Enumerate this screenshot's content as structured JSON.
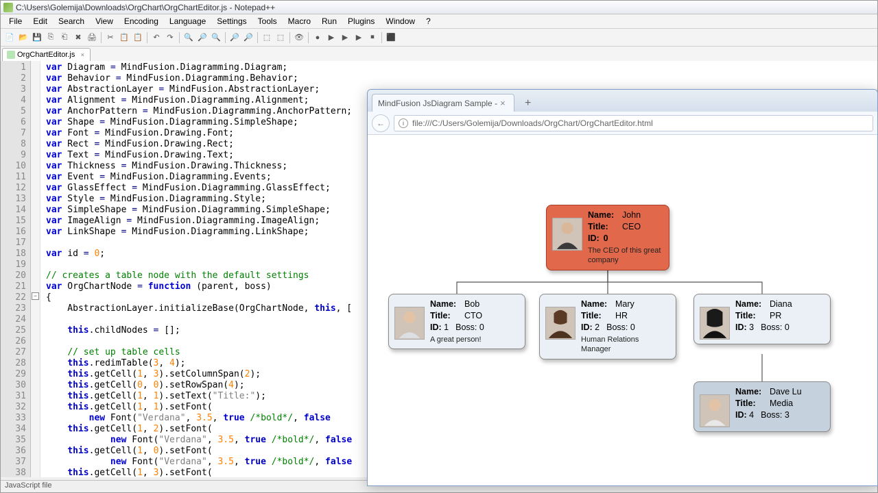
{
  "npp": {
    "title": "C:\\Users\\Golemija\\Downloads\\OrgChart\\OrgChartEditor.js - Notepad++",
    "menus": [
      "File",
      "Edit",
      "Search",
      "View",
      "Encoding",
      "Language",
      "Settings",
      "Tools",
      "Macro",
      "Run",
      "Plugins",
      "Window",
      "?"
    ],
    "tab": "OrgChartEditor.js",
    "status": "JavaScript file",
    "foldLine": 22
  },
  "code": [
    {
      "n": 1,
      "t": "<kw>var</kw> Diagram <op>=</op> MindFusion.Diagramming.Diagram;"
    },
    {
      "n": 2,
      "t": "<kw>var</kw> Behavior <op>=</op> MindFusion.Diagramming.Behavior;"
    },
    {
      "n": 3,
      "t": "<kw>var</kw> AbstractionLayer <op>=</op> MindFusion.AbstractionLayer;"
    },
    {
      "n": 4,
      "t": "<kw>var</kw> Alignment <op>=</op> MindFusion.Diagramming.Alignment;"
    },
    {
      "n": 5,
      "t": "<kw>var</kw> AnchorPattern <op>=</op> MindFusion.Diagramming.AnchorPattern;"
    },
    {
      "n": 6,
      "t": "<kw>var</kw> Shape <op>=</op> MindFusion.Diagramming.SimpleShape;"
    },
    {
      "n": 7,
      "t": "<kw>var</kw> Font <op>=</op> MindFusion.Drawing.Font;"
    },
    {
      "n": 8,
      "t": "<kw>var</kw> Rect <op>=</op> MindFusion.Drawing.Rect;"
    },
    {
      "n": 9,
      "t": "<kw>var</kw> Text <op>=</op> MindFusion.Drawing.Text;"
    },
    {
      "n": 10,
      "t": "<kw>var</kw> Thickness <op>=</op> MindFusion.Drawing.Thickness;"
    },
    {
      "n": 11,
      "t": "<kw>var</kw> Event <op>=</op> MindFusion.Diagramming.Events;"
    },
    {
      "n": 12,
      "t": "<kw>var</kw> GlassEffect <op>=</op> MindFusion.Diagramming.GlassEffect;"
    },
    {
      "n": 13,
      "t": "<kw>var</kw> Style <op>=</op> MindFusion.Diagramming.Style;"
    },
    {
      "n": 14,
      "t": "<kw>var</kw> SimpleShape <op>=</op> MindFusion.Diagramming.SimpleShape;"
    },
    {
      "n": 15,
      "t": "<kw>var</kw> ImageAlign <op>=</op> MindFusion.Diagramming.ImageAlign;"
    },
    {
      "n": 16,
      "t": "<kw>var</kw> LinkShape <op>=</op> MindFusion.Diagramming.LinkShape;"
    },
    {
      "n": 17,
      "t": ""
    },
    {
      "n": 18,
      "t": "<kw>var</kw> id <op>=</op> <num>0</num>;"
    },
    {
      "n": 19,
      "t": ""
    },
    {
      "n": 20,
      "t": "<cm>// creates a table node with the default settings</cm>"
    },
    {
      "n": 21,
      "t": "<kw>var</kw> OrgChartNode <op>=</op> <kw>function</kw> (parent, boss)"
    },
    {
      "n": 22,
      "t": "{"
    },
    {
      "n": 23,
      "t": "    AbstractionLayer.initializeBase(OrgChartNode, <kw>this</kw>, ["
    },
    {
      "n": 24,
      "t": ""
    },
    {
      "n": 25,
      "t": "    <kw>this</kw>.childNodes <op>=</op> [];"
    },
    {
      "n": 26,
      "t": ""
    },
    {
      "n": 27,
      "t": "    <cm>// set up table cells</cm>"
    },
    {
      "n": 28,
      "t": "    <kw>this</kw>.redimTable(<num>3</num>, <num>4</num>);"
    },
    {
      "n": 29,
      "t": "    <kw>this</kw>.getCell(<num>1</num>, <num>3</num>).setColumnSpan(<num>2</num>);"
    },
    {
      "n": 30,
      "t": "    <kw>this</kw>.getCell(<num>0</num>, <num>0</num>).setRowSpan(<num>4</num>);"
    },
    {
      "n": 31,
      "t": "    <kw>this</kw>.getCell(<num>1</num>, <num>1</num>).setText(<str>\"Title:\"</str>);"
    },
    {
      "n": 32,
      "t": "    <kw>this</kw>.getCell(<num>1</num>, <num>1</num>).setFont("
    },
    {
      "n": 33,
      "t": "        <kw>new</kw> Font(<str>\"Verdana\"</str>, <num>3.5</num>, <kw>true</kw> <cm>/*bold*/</cm>, <kw>false</kw>"
    },
    {
      "n": 34,
      "t": "    <kw>this</kw>.getCell(<num>1</num>, <num>2</num>).setFont("
    },
    {
      "n": 35,
      "t": "            <kw>new</kw> Font(<str>\"Verdana\"</str>, <num>3.5</num>, <kw>true</kw> <cm>/*bold*/</cm>, <kw>false</kw>"
    },
    {
      "n": 36,
      "t": "    <kw>this</kw>.getCell(<num>1</num>, <num>0</num>).setFont("
    },
    {
      "n": 37,
      "t": "            <kw>new</kw> Font(<str>\"Verdana\"</str>, <num>3.5</num>, <kw>true</kw> <cm>/*bold*/</cm>, <kw>false</kw>"
    },
    {
      "n": 38,
      "t": "    <kw>this</kw>.getCell(<num>1</num>, <num>3</num>).setFont("
    }
  ],
  "browser": {
    "tabTitle": "MindFusion JsDiagram Sample -",
    "url": "file:///C:/Users/Golemija/Downloads/OrgChart/OrgChartEditor.html"
  },
  "labels": {
    "name": "Name:",
    "title": "Title:",
    "id": "ID:",
    "boss": "Boss:"
  },
  "nodes": {
    "root": {
      "name": "John",
      "title": "CEO",
      "id": "0",
      "comment": "The CEO of this great company"
    },
    "n1": {
      "name": "Bob",
      "title": "CTO",
      "id": "1",
      "boss": "0",
      "comment": "A great person!"
    },
    "n2": {
      "name": "Mary",
      "title": "HR",
      "id": "2",
      "boss": "0",
      "comment": "Human Relations Manager"
    },
    "n3": {
      "name": "Diana",
      "title": "PR",
      "id": "3",
      "boss": "0",
      "comment": ""
    },
    "n4": {
      "name": "Dave Lu",
      "title": "Media",
      "id": "4",
      "boss": "3",
      "comment": ""
    }
  }
}
